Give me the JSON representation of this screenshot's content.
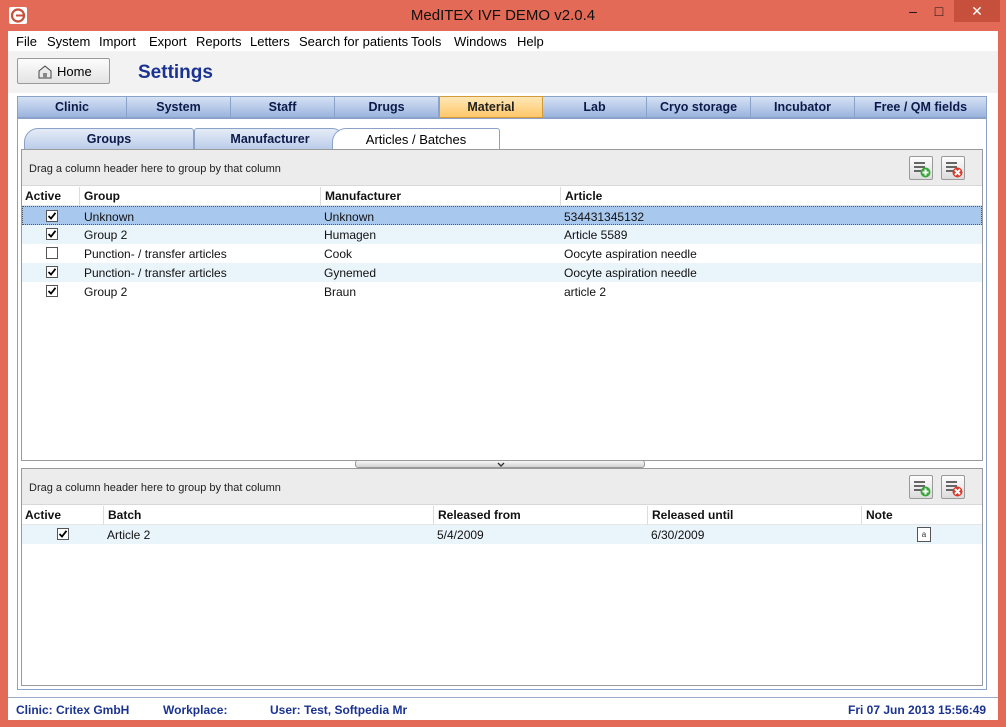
{
  "window": {
    "title": "MedITEX IVF DEMO v2.0.4",
    "min": "‒",
    "max": "□",
    "close": "✕"
  },
  "menu": [
    "File",
    "System",
    "Import",
    "Export",
    "Reports",
    "Letters",
    "Search for patients",
    "Tools",
    "Windows",
    "Help"
  ],
  "toolbar": {
    "home_label": "Home",
    "page_title": "Settings"
  },
  "main_tabs": [
    "Clinic",
    "System",
    "Staff",
    "Drugs",
    "Material",
    "Lab",
    "Cryo storage",
    "Incubator",
    "Free / QM fields"
  ],
  "main_tab_active": "Material",
  "sub_tabs": [
    "Groups",
    "Manufacturer",
    "Articles / Batches"
  ],
  "sub_tab_active": "Articles / Batches",
  "articles_grid": {
    "group_hint": "Drag a column header here to group by that column",
    "columns": [
      "Active",
      "Group",
      "Manufacturer",
      "Article"
    ],
    "rows": [
      {
        "active": true,
        "group": "Unknown",
        "manufacturer": "Unknown",
        "article": "534431345132"
      },
      {
        "active": true,
        "group": "Group 2",
        "manufacturer": "Humagen",
        "article": "Article 5589"
      },
      {
        "active": false,
        "group": "Punction- / transfer articles",
        "manufacturer": "Cook",
        "article": "Oocyte aspiration needle"
      },
      {
        "active": true,
        "group": "Punction- / transfer articles",
        "manufacturer": "Gynemed",
        "article": "Oocyte aspiration needle"
      },
      {
        "active": true,
        "group": "Group 2",
        "manufacturer": "Braun",
        "article": "article 2"
      }
    ],
    "selected_row": 0
  },
  "batches_grid": {
    "group_hint": "Drag a column header here to group by that column",
    "columns": [
      "Active",
      "Batch",
      "Released from",
      "Released until",
      "Note"
    ],
    "rows": [
      {
        "active": true,
        "batch": "Article 2",
        "released_from": "5/4/2009",
        "released_until": "6/30/2009",
        "note": "a"
      }
    ]
  },
  "status": {
    "clinic": "Clinic: Critex GmbH",
    "workplace": "Workplace:",
    "user": "User: Test, Softpedia Mr",
    "datetime": "Fri 07 Jun 2013 15:56:49"
  },
  "colors": {
    "frame": "#e26a56",
    "accent_text": "#1a3391",
    "tab_active": "#ffc76a",
    "row_selected": "#a9c8ed"
  }
}
